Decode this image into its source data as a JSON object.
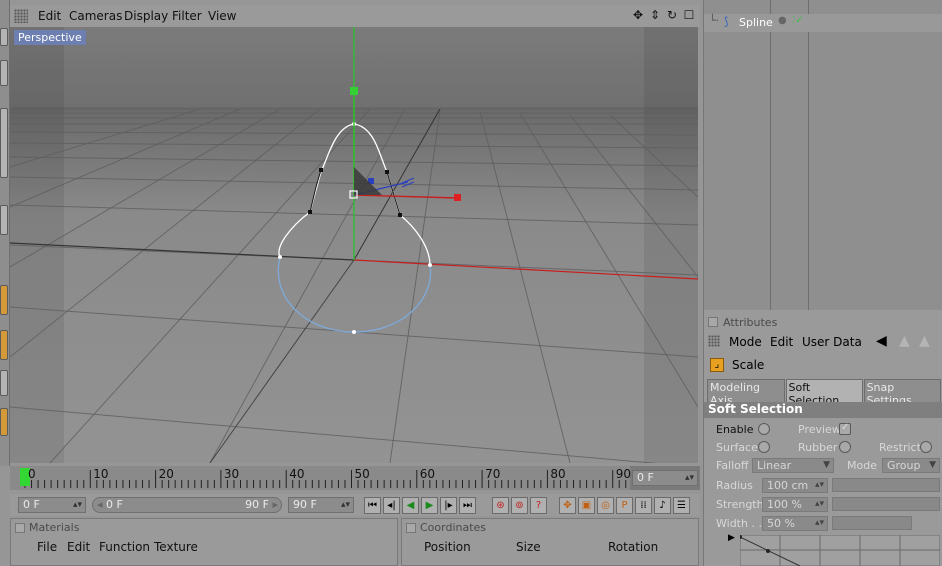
{
  "viewport": {
    "menu": [
      "Edit",
      "Cameras",
      "Display",
      "Filter",
      "View"
    ],
    "label": "Perspective",
    "nav_icons": [
      "move-view-icon",
      "dolly-icon",
      "rotate-view-icon",
      "maximize-view-icon"
    ]
  },
  "object_manager": {
    "object_name": "Spline",
    "check_color": "#3fbf3f"
  },
  "attributes": {
    "title": "Attributes",
    "menu": [
      "Mode",
      "Edit",
      "User Data"
    ],
    "tool_name": "Scale",
    "tabs": [
      "Modeling Axis",
      "Soft Selection",
      "Snap Settings"
    ],
    "active_tab": "Soft Selection",
    "section": "Soft Selection",
    "enable_label": "Enable",
    "preview_label": "Preview",
    "surface_label": "Surface",
    "rubber_label": "Rubber",
    "restrict_label": "Restrict",
    "falloff_label": "Falloff",
    "falloff_value": "Linear",
    "mode_label": "Mode",
    "mode_value": "Group",
    "radius_label": "Radius",
    "radius_value": "100 cm",
    "strength_label": "Strength",
    "strength_value": "100 %",
    "width_label": "Width . .",
    "width_value": "50 %"
  },
  "timeline": {
    "ticks": [
      "0",
      "10",
      "20",
      "30",
      "40",
      "50",
      "60",
      "70",
      "80",
      "90"
    ],
    "current_frame": "0 F",
    "start_field": "0 F",
    "range_start": "0 F",
    "range_end": "90 F",
    "end_field": "90 F"
  },
  "materials": {
    "title": "Materials",
    "menu": [
      "File",
      "Edit",
      "Function",
      "Texture"
    ]
  },
  "coordinates": {
    "title": "Coordinates",
    "columns": [
      "Position",
      "Size",
      "Rotation"
    ]
  },
  "colors": {
    "axis_x": "#c81e1e",
    "axis_y": "#2fbf2f",
    "axis_z": "#2a3fbf",
    "spline_active": "#ffffff",
    "spline_inactive": "#7fa8d6",
    "viewport_label_bg": "#6c7fb0"
  }
}
